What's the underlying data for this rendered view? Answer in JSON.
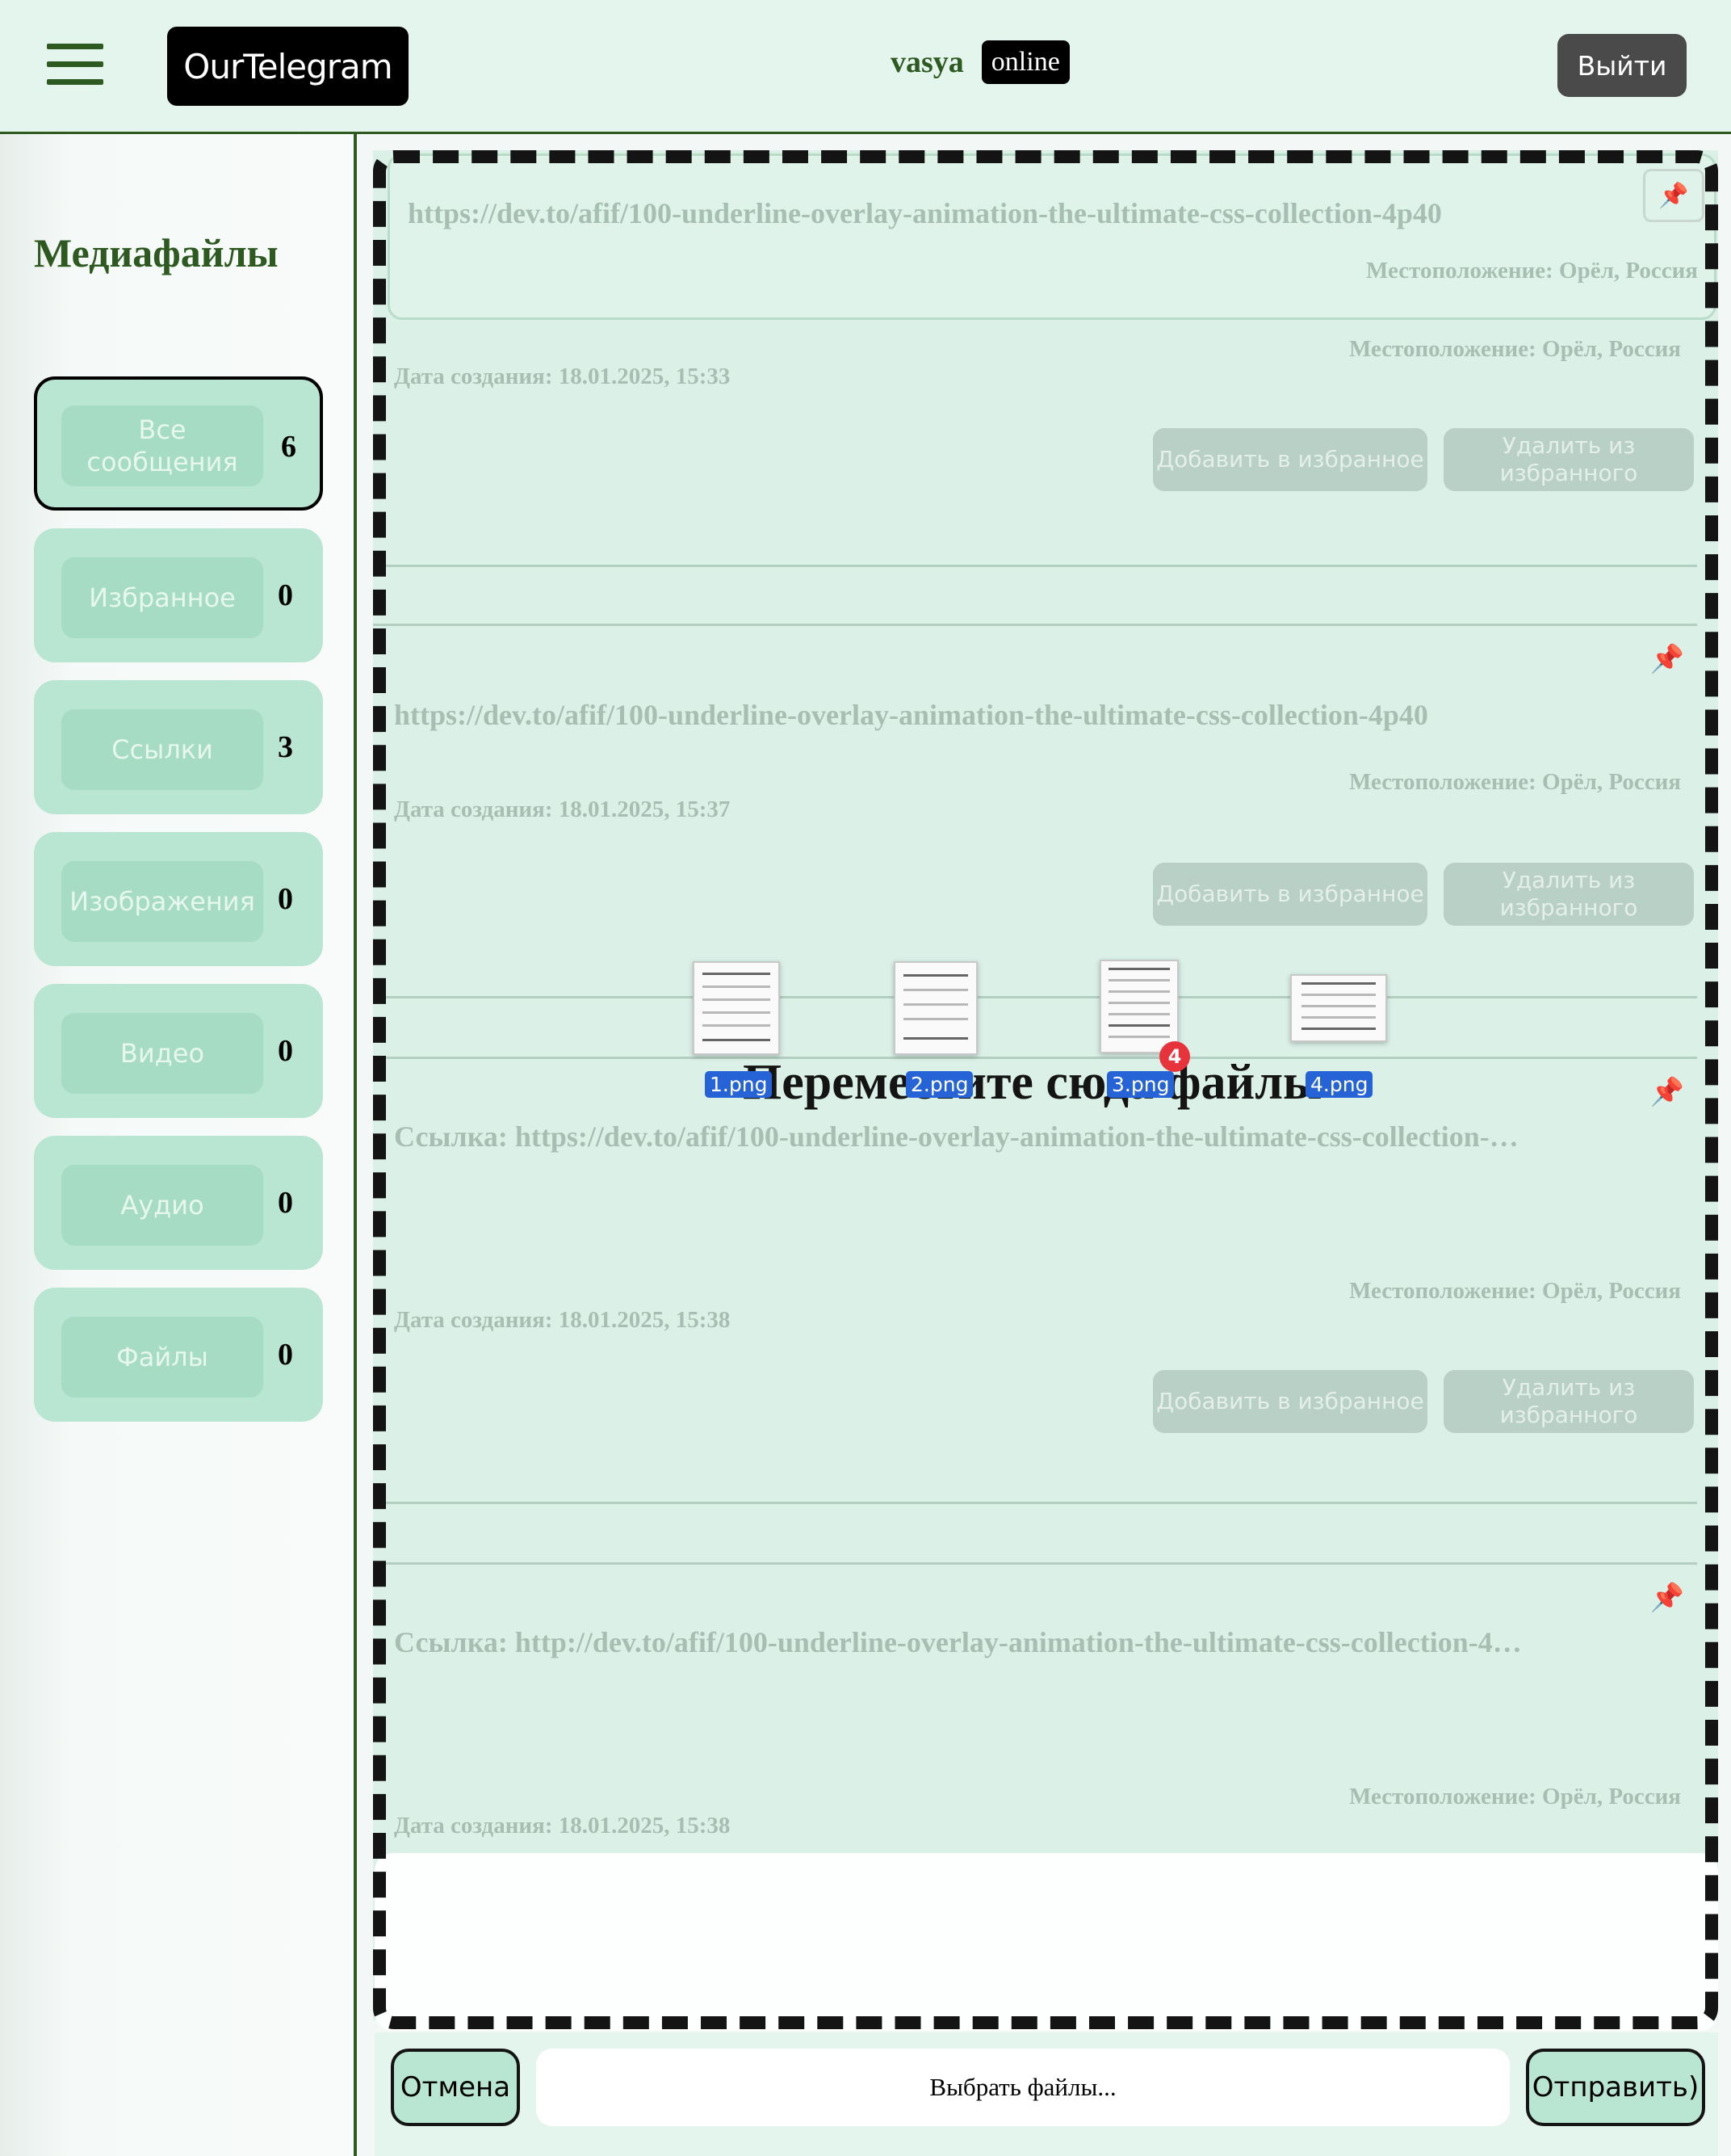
{
  "header": {
    "logo": "OurTelegram",
    "username": "vasya",
    "status": "online",
    "logout_label": "Выйти"
  },
  "sidebar": {
    "title": "Медиафайлы",
    "categories": [
      {
        "label": "Все сообщения",
        "count": "6",
        "active": true
      },
      {
        "label": "Избранное",
        "count": "0"
      },
      {
        "label": "Ссылки",
        "count": "3"
      },
      {
        "label": "Изображения",
        "count": "0"
      },
      {
        "label": "Видео",
        "count": "0"
      },
      {
        "label": "Аудио",
        "count": "0"
      },
      {
        "label": "Файлы",
        "count": "0"
      }
    ]
  },
  "messages": [
    {
      "link": "https://dev.to/afif/100-underline-overlay-animation-the-ultimate-css-collection-4p40",
      "location": "Местоположение: Орёл, Россия"
    },
    {
      "location": "Местоположение: Орёл, Россия",
      "date": "Дата создания: 18.01.2025, 15:33",
      "fav_label": "Добавить в избранное",
      "unfav_label": "Удалить из избранного"
    },
    {
      "link": "https://dev.to/afif/100-underline-overlay-animation-the-ultimate-css-collection-4p40",
      "location": "Местоположение: Орёл, Россия",
      "date": "Дата создания: 18.01.2025, 15:37",
      "fav_label": "Добавить в избранное",
      "unfav_label": "Удалить из избранного"
    },
    {
      "link": "Ссылка: https://dev.to/afif/100-underline-overlay-animation-the-ultimate-css-collection-…",
      "location": "Местоположение: Орёл, Россия",
      "date": "Дата создания: 18.01.2025, 15:38",
      "fav_label": "Добавить в избранное",
      "unfav_label": "Удалить из избранного"
    },
    {
      "link": "Ссылка: http://dev.to/afif/100-underline-overlay-animation-the-ultimate-css-collection-4…",
      "location": "Местоположение: Орёл, Россия",
      "date": "Дата создания: 18.01.2025, 15:38"
    }
  ],
  "drop_zone": {
    "text": "Переместите сюда файлы",
    "files": [
      "1.png",
      "2.png",
      "3.png",
      "4.png"
    ],
    "badge_count": "4"
  },
  "footer": {
    "cancel_label": "Отмена",
    "file_placeholder": "Выбрать файлы...",
    "send_label": "Отправить)"
  },
  "colors": {
    "accent": "#2e5a22",
    "header_bg": "#e4f5ee",
    "category_bg": "#b9e6d2",
    "file_label_bg": "#2563d6",
    "badge_bg": "#e7333c"
  }
}
